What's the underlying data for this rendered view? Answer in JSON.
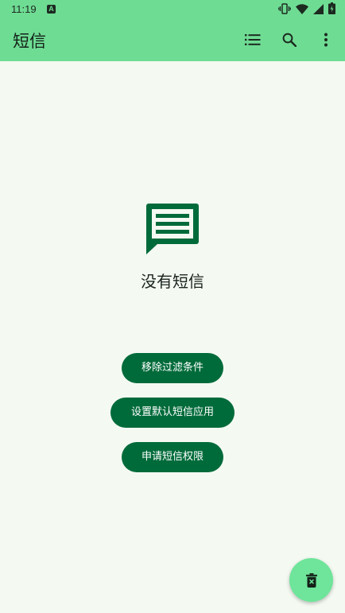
{
  "status_bar": {
    "time": "11:19",
    "notification_icon": "a-letter-icon",
    "icons": [
      "vibrate-icon",
      "wifi-icon",
      "cellular-signal-icon",
      "battery-icon"
    ]
  },
  "app_bar": {
    "title": "短信",
    "actions": [
      "list-icon",
      "search-icon",
      "more-vert-icon"
    ]
  },
  "empty_state": {
    "icon": "message-icon",
    "text": "没有短信"
  },
  "buttons": {
    "remove_filter": "移除过滤条件",
    "set_default_app": "设置默认短信应用",
    "request_permission": "申请短信权限"
  },
  "fab": {
    "icon": "delete-icon"
  },
  "colors": {
    "app_bar_bg": "#6fdc94",
    "background": "#f4f9f2",
    "primary": "#006b3a",
    "fab_bg": "#6ee59a"
  }
}
